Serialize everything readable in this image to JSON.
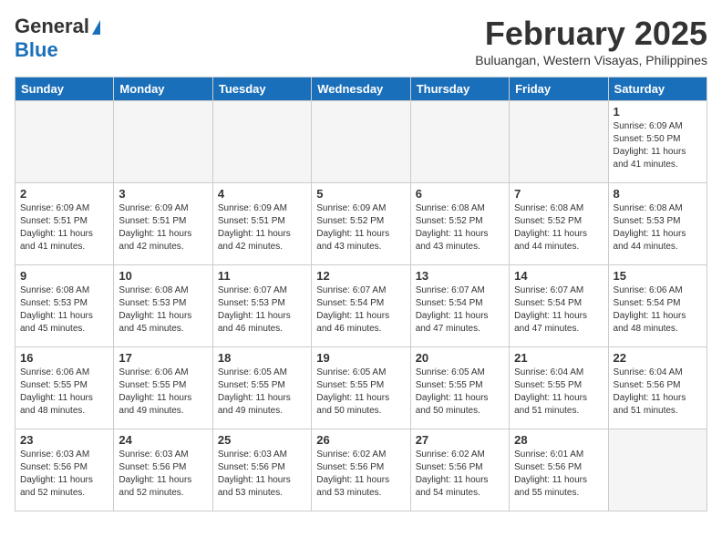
{
  "logo": {
    "general": "General",
    "blue": "Blue",
    "tagline": ""
  },
  "title": {
    "month_year": "February 2025",
    "location": "Buluangan, Western Visayas, Philippines"
  },
  "headers": [
    "Sunday",
    "Monday",
    "Tuesday",
    "Wednesday",
    "Thursday",
    "Friday",
    "Saturday"
  ],
  "weeks": [
    [
      {
        "day": "",
        "info": ""
      },
      {
        "day": "",
        "info": ""
      },
      {
        "day": "",
        "info": ""
      },
      {
        "day": "",
        "info": ""
      },
      {
        "day": "",
        "info": ""
      },
      {
        "day": "",
        "info": ""
      },
      {
        "day": "1",
        "info": "Sunrise: 6:09 AM\nSunset: 5:50 PM\nDaylight: 11 hours\nand 41 minutes."
      }
    ],
    [
      {
        "day": "2",
        "info": "Sunrise: 6:09 AM\nSunset: 5:51 PM\nDaylight: 11 hours\nand 41 minutes."
      },
      {
        "day": "3",
        "info": "Sunrise: 6:09 AM\nSunset: 5:51 PM\nDaylight: 11 hours\nand 42 minutes."
      },
      {
        "day": "4",
        "info": "Sunrise: 6:09 AM\nSunset: 5:51 PM\nDaylight: 11 hours\nand 42 minutes."
      },
      {
        "day": "5",
        "info": "Sunrise: 6:09 AM\nSunset: 5:52 PM\nDaylight: 11 hours\nand 43 minutes."
      },
      {
        "day": "6",
        "info": "Sunrise: 6:08 AM\nSunset: 5:52 PM\nDaylight: 11 hours\nand 43 minutes."
      },
      {
        "day": "7",
        "info": "Sunrise: 6:08 AM\nSunset: 5:52 PM\nDaylight: 11 hours\nand 44 minutes."
      },
      {
        "day": "8",
        "info": "Sunrise: 6:08 AM\nSunset: 5:53 PM\nDaylight: 11 hours\nand 44 minutes."
      }
    ],
    [
      {
        "day": "9",
        "info": "Sunrise: 6:08 AM\nSunset: 5:53 PM\nDaylight: 11 hours\nand 45 minutes."
      },
      {
        "day": "10",
        "info": "Sunrise: 6:08 AM\nSunset: 5:53 PM\nDaylight: 11 hours\nand 45 minutes."
      },
      {
        "day": "11",
        "info": "Sunrise: 6:07 AM\nSunset: 5:53 PM\nDaylight: 11 hours\nand 46 minutes."
      },
      {
        "day": "12",
        "info": "Sunrise: 6:07 AM\nSunset: 5:54 PM\nDaylight: 11 hours\nand 46 minutes."
      },
      {
        "day": "13",
        "info": "Sunrise: 6:07 AM\nSunset: 5:54 PM\nDaylight: 11 hours\nand 47 minutes."
      },
      {
        "day": "14",
        "info": "Sunrise: 6:07 AM\nSunset: 5:54 PM\nDaylight: 11 hours\nand 47 minutes."
      },
      {
        "day": "15",
        "info": "Sunrise: 6:06 AM\nSunset: 5:54 PM\nDaylight: 11 hours\nand 48 minutes."
      }
    ],
    [
      {
        "day": "16",
        "info": "Sunrise: 6:06 AM\nSunset: 5:55 PM\nDaylight: 11 hours\nand 48 minutes."
      },
      {
        "day": "17",
        "info": "Sunrise: 6:06 AM\nSunset: 5:55 PM\nDaylight: 11 hours\nand 49 minutes."
      },
      {
        "day": "18",
        "info": "Sunrise: 6:05 AM\nSunset: 5:55 PM\nDaylight: 11 hours\nand 49 minutes."
      },
      {
        "day": "19",
        "info": "Sunrise: 6:05 AM\nSunset: 5:55 PM\nDaylight: 11 hours\nand 50 minutes."
      },
      {
        "day": "20",
        "info": "Sunrise: 6:05 AM\nSunset: 5:55 PM\nDaylight: 11 hours\nand 50 minutes."
      },
      {
        "day": "21",
        "info": "Sunrise: 6:04 AM\nSunset: 5:55 PM\nDaylight: 11 hours\nand 51 minutes."
      },
      {
        "day": "22",
        "info": "Sunrise: 6:04 AM\nSunset: 5:56 PM\nDaylight: 11 hours\nand 51 minutes."
      }
    ],
    [
      {
        "day": "23",
        "info": "Sunrise: 6:03 AM\nSunset: 5:56 PM\nDaylight: 11 hours\nand 52 minutes."
      },
      {
        "day": "24",
        "info": "Sunrise: 6:03 AM\nSunset: 5:56 PM\nDaylight: 11 hours\nand 52 minutes."
      },
      {
        "day": "25",
        "info": "Sunrise: 6:03 AM\nSunset: 5:56 PM\nDaylight: 11 hours\nand 53 minutes."
      },
      {
        "day": "26",
        "info": "Sunrise: 6:02 AM\nSunset: 5:56 PM\nDaylight: 11 hours\nand 53 minutes."
      },
      {
        "day": "27",
        "info": "Sunrise: 6:02 AM\nSunset: 5:56 PM\nDaylight: 11 hours\nand 54 minutes."
      },
      {
        "day": "28",
        "info": "Sunrise: 6:01 AM\nSunset: 5:56 PM\nDaylight: 11 hours\nand 55 minutes."
      },
      {
        "day": "",
        "info": ""
      }
    ]
  ]
}
